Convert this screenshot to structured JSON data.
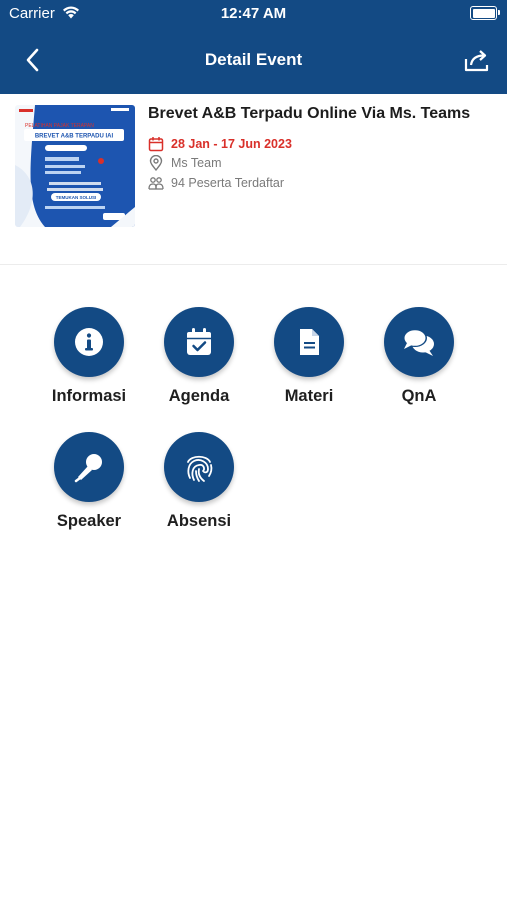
{
  "status_bar": {
    "carrier": "Carrier",
    "time": "12:47 AM"
  },
  "header": {
    "title": "Detail Event"
  },
  "event": {
    "title": "Brevet A&B Terpadu Online Via Ms. Teams",
    "date": "28 Jan - 17 Jun 2023",
    "location": "Ms Team",
    "participants": "94 Peserta Terdaftar",
    "poster": {
      "heading": "PELATIHAN PAJAK TERAPAN",
      "title": "BREVET A&B TERPADU IAI",
      "badge": "TEMUKAN SOLUSI"
    }
  },
  "menu": [
    {
      "label": "Informasi",
      "icon": "info-icon"
    },
    {
      "label": "Agenda",
      "icon": "calendar-check-icon"
    },
    {
      "label": "Materi",
      "icon": "document-icon"
    },
    {
      "label": "QnA",
      "icon": "chat-bubbles-icon"
    },
    {
      "label": "Speaker",
      "icon": "microphone-icon"
    },
    {
      "label": "Absensi",
      "icon": "fingerprint-icon"
    }
  ],
  "colors": {
    "primary": "#134a84",
    "date": "#d9302a"
  }
}
